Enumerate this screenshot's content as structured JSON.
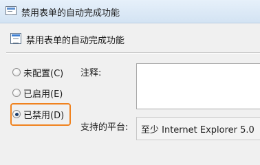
{
  "window": {
    "title": "禁用表单的自动完成功能"
  },
  "header": {
    "title": "禁用表单的自动完成功能"
  },
  "options": {
    "not_configured": "未配置(C)",
    "enabled": "已启用(E)",
    "disabled": "已禁用(D)",
    "selected": "disabled"
  },
  "comment": {
    "label": "注释:",
    "value": ""
  },
  "platform": {
    "label": "支持的平台:",
    "value": "至少 Internet Explorer 5.0"
  },
  "colors": {
    "focus_outline": "#f0821e",
    "titlebar": "#dbe7f4"
  },
  "icons": {
    "window": "policy-setting-icon",
    "header": "policy-setting-icon"
  }
}
